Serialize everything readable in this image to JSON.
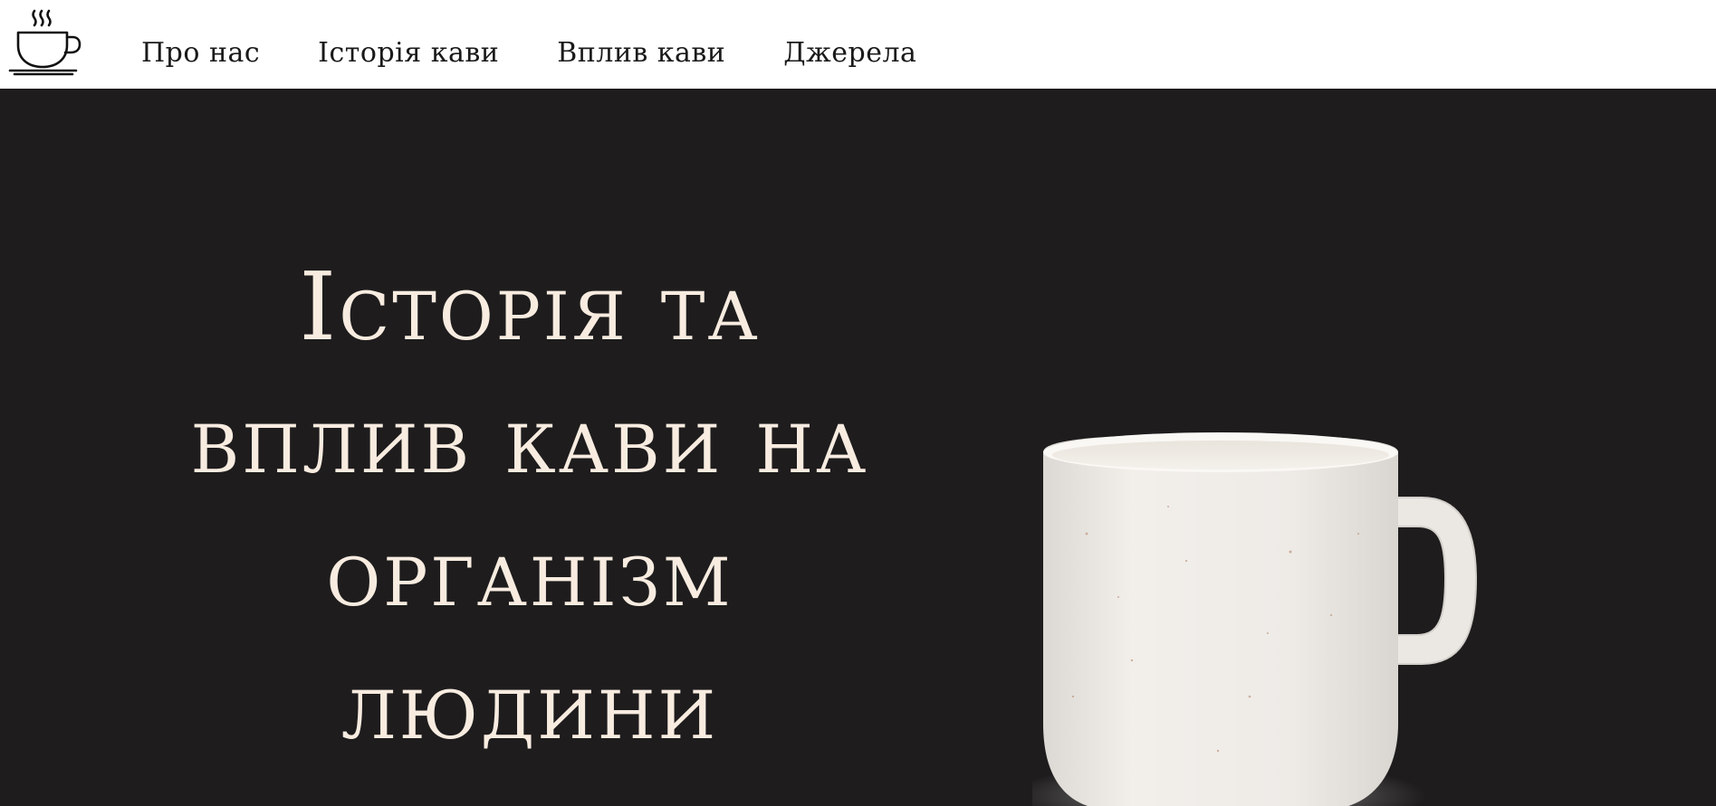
{
  "nav": {
    "links": [
      {
        "label": "Про нас"
      },
      {
        "label": "Історія кави"
      },
      {
        "label": "Вплив кави"
      },
      {
        "label": "Джерела"
      }
    ]
  },
  "hero": {
    "title": "Історія та вплив кави на організм людини"
  },
  "icons": {
    "logo": "coffee-cup-icon",
    "hero_image": "white-mug-image"
  },
  "colors": {
    "nav_background": "#ffffff",
    "hero_background": "#1e1c1d",
    "hero_text": "#f8ece0",
    "nav_text": "#1a1a1a"
  }
}
